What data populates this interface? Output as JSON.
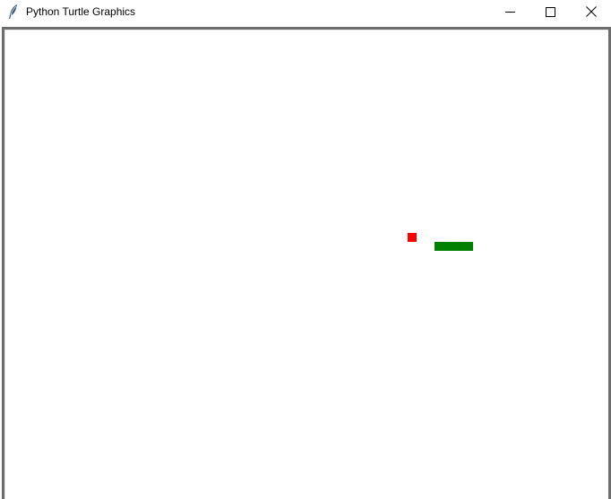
{
  "window": {
    "title": "Python Turtle Graphics",
    "icon": "feather-icon",
    "controls": [
      "minimize-icon",
      "maximize-icon",
      "close-icon"
    ]
  },
  "canvas": {
    "background": "#ffffff",
    "food": {
      "color": "#ff0000"
    },
    "snake": {
      "color": "#008000"
    }
  }
}
